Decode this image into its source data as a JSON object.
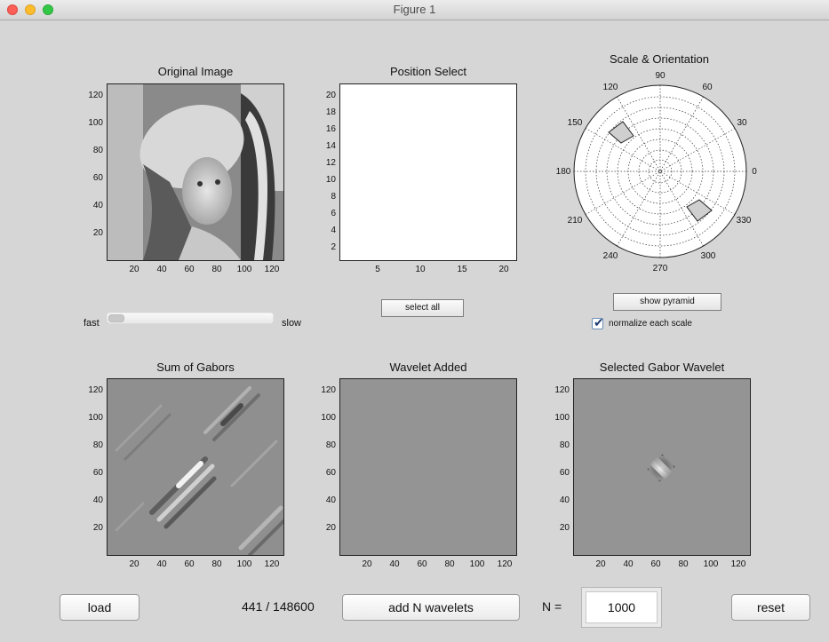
{
  "window": {
    "title": "Figure 1"
  },
  "axes": {
    "original": {
      "title": "Original Image",
      "yticks": [
        "120",
        "100",
        "80",
        "60",
        "40",
        "20"
      ],
      "xticks": [
        "20",
        "40",
        "60",
        "80",
        "100",
        "120"
      ]
    },
    "position": {
      "title": "Position Select",
      "yticks": [
        "20",
        "18",
        "16",
        "14",
        "12",
        "10",
        "8",
        "6",
        "4",
        "2"
      ],
      "xticks": [
        "5",
        "10",
        "15",
        "20"
      ]
    },
    "scale": {
      "title": "Scale & Orientation",
      "angles": [
        "90",
        "60",
        "30",
        "0",
        "330",
        "300",
        "270",
        "240",
        "210",
        "180",
        "150",
        "120"
      ]
    },
    "sum": {
      "title": "Sum of Gabors",
      "yticks": [
        "120",
        "100",
        "80",
        "60",
        "40",
        "20"
      ],
      "xticks": [
        "20",
        "40",
        "60",
        "80",
        "100",
        "120"
      ]
    },
    "added": {
      "title": "Wavelet Added",
      "yticks": [
        "120",
        "100",
        "80",
        "60",
        "40",
        "20"
      ],
      "xticks": [
        "20",
        "40",
        "60",
        "80",
        "100",
        "120"
      ]
    },
    "selected": {
      "title": "Selected Gabor Wavelet",
      "yticks": [
        "120",
        "100",
        "80",
        "60",
        "40",
        "20"
      ],
      "xticks": [
        "20",
        "40",
        "60",
        "80",
        "100",
        "120"
      ]
    }
  },
  "speed": {
    "fast_label": "fast",
    "slow_label": "slow",
    "value": 0.0
  },
  "controls": {
    "select_all": "select all",
    "show_pyramid": "show pyramid",
    "normalize_label": "normalize each scale",
    "normalize_checked": true,
    "load": "load",
    "count": "441 / 148600",
    "add_n": "add N wavelets",
    "n_label": "N =",
    "n_value": "1000",
    "reset": "reset"
  }
}
